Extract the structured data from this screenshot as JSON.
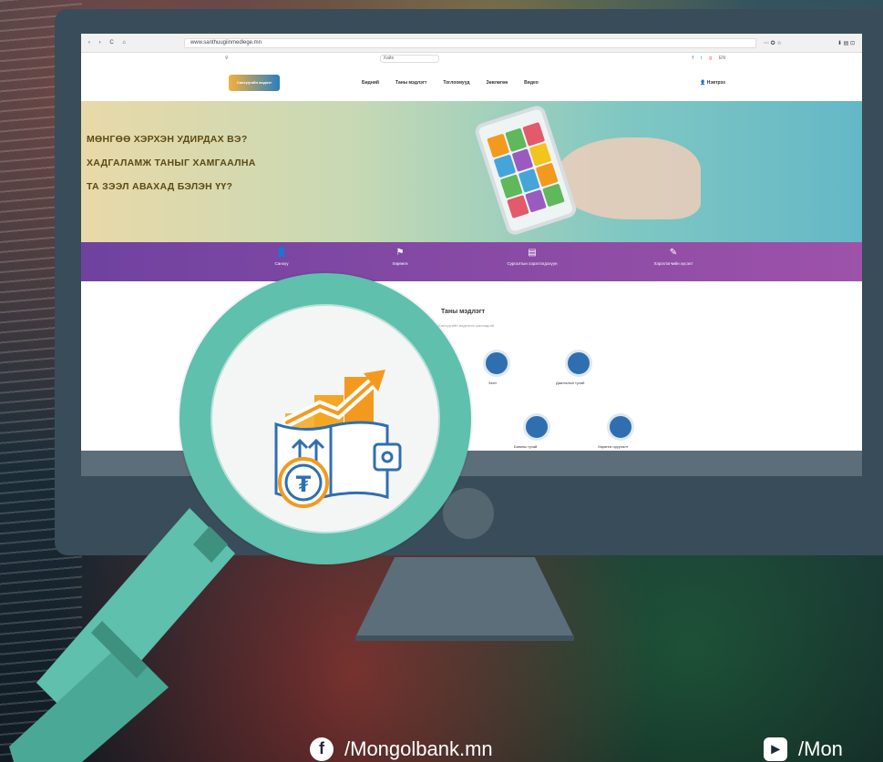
{
  "browser": {
    "nav": "‹ › C ⌂",
    "url": "www.santhuugiinmedlege.mn",
    "right": "⋯ ✪ ☆",
    "extras": "⬇ ▤ ⊡"
  },
  "topbar": {
    "search": "Хайх",
    "socials": [
      "f",
      "t",
      "g",
      "EN"
    ]
  },
  "site": {
    "logo": "Санхүүгийн мэдлэг",
    "menu": [
      "Бидний",
      "Таны мэдлэгт",
      "Тоглоомууд",
      "Зөвлөгөө",
      "Видео"
    ],
    "login": "Нэвтрэх"
  },
  "hero": {
    "lines": [
      "МӨНГӨӨ ХЭРХЭН УДИРДАХ ВЭ?",
      "ХАДГАЛАМЖ ТАНЫГ ХАМГААЛНА",
      "ТА ЗЭЭЛ АВАХАД БЭЛЭН ҮҮ?"
    ]
  },
  "purple_bar": {
    "items": [
      {
        "label": "Санхүү",
        "icon": "user-icon"
      },
      {
        "label": "Хөрөнгө",
        "icon": "flag-icon"
      },
      {
        "label": "Сургалтын хэрэглэгдэхүүн",
        "icon": "document-icon"
      },
      {
        "label": "Хэрэглэгчийн хүсэлт",
        "icon": "pencil-icon"
      }
    ]
  },
  "content": {
    "title": "Таны мэдлэгт",
    "subtitle": "Санхүүгийн мэдлэгээ шалгаарай",
    "circles": [
      {
        "label": "Зээл",
        "icon": "bank-card-icon"
      },
      {
        "label": "Даатгалын тухай",
        "icon": "umbrella-icon"
      },
      {
        "label": "Банкны тухай",
        "icon": "bank-icon"
      },
      {
        "label": "Хөрөнгө оруулалт",
        "icon": "investment-icon"
      }
    ]
  },
  "socials_footer": [
    {
      "icon": "facebook-icon",
      "glyph": "f",
      "text": "/Mongolbank.mn"
    },
    {
      "icon": "youtube-icon",
      "glyph": "▸",
      "text": "/Mon"
    }
  ],
  "colors": {
    "monitor": "#394c59",
    "lens_ring": "#5ec0ad",
    "purple_start": "#6f42a0",
    "purple_end": "#9e52a9",
    "accent_orange": "#f39a1e",
    "wallet_blue": "#2f6fb0"
  }
}
